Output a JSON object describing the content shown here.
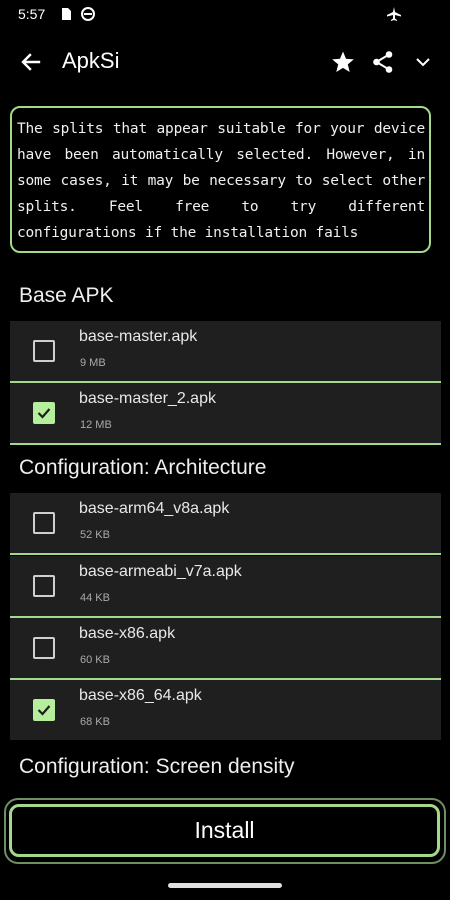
{
  "status_bar": {
    "time": "5:57",
    "icons": [
      "sd-card-icon",
      "vpn-icon",
      "airplane-icon"
    ]
  },
  "app_bar": {
    "title": "ApkSi",
    "back_icon": "back-arrow-icon",
    "actions": [
      "star-icon",
      "share-icon",
      "chevron-down-icon"
    ]
  },
  "info": {
    "text": "The splits that appear suitable for your device have been automatically selected. However, in some cases, it may be necessary to select other splits. Feel free to try different configurations if the installation fails"
  },
  "sections": {
    "base": {
      "title": "Base APK",
      "items": [
        {
          "name": "base-master.apk",
          "size": "9 MB",
          "checked": false
        },
        {
          "name": "base-master_2.apk",
          "size": "12 MB",
          "checked": true
        }
      ]
    },
    "architecture": {
      "title": "Configuration: Architecture",
      "items": [
        {
          "name": "base-arm64_v8a.apk",
          "size": "52 KB",
          "checked": false
        },
        {
          "name": "base-armeabi_v7a.apk",
          "size": "44 KB",
          "checked": false
        },
        {
          "name": "base-x86.apk",
          "size": "60 KB",
          "checked": false
        },
        {
          "name": "base-x86_64.apk",
          "size": "68 KB",
          "checked": true
        }
      ]
    },
    "density": {
      "title": "Configuration: Screen density"
    }
  },
  "install": {
    "label": "Install"
  },
  "colors": {
    "accent": "#a3d98a",
    "checked": "#b5ef9c",
    "row_bg": "#1f1f1f",
    "background": "#000000"
  }
}
